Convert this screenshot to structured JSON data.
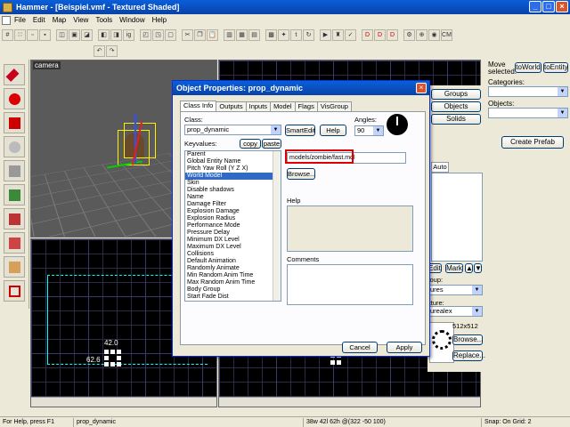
{
  "window": {
    "title": "Hammer - [Beispiel.vmf - Textured Shaded]"
  },
  "menu": [
    "File",
    "Edit",
    "Map",
    "View",
    "Tools",
    "Window",
    "Help"
  ],
  "viewports": {
    "camera_label": "camera",
    "numbers": {
      "a": "42.0",
      "b": "62.6"
    }
  },
  "right_panel": {
    "move_selected": "Move selected:",
    "to_world": "toWorld",
    "to_entity": "toEntity",
    "categories": "Categories:",
    "objects": "Objects:",
    "create_prefab": "Create Prefab",
    "groups": "Groups",
    "objects_btn": "Objects",
    "solids": "Solids",
    "auto": "Auto",
    "edit": "Edit",
    "mark": "Mark",
    "group": "roup:",
    "group_value": "ures",
    "texture": "xture:",
    "texture_value": "urealex",
    "size": "512x512",
    "browse": "Browse...",
    "replace": "Replace..."
  },
  "dialog": {
    "title": "Object Properties: prop_dynamic",
    "tabs": [
      "Class Info",
      "Outputs",
      "Inputs",
      "Model",
      "Flags",
      "VisGroup"
    ],
    "class_label": "Class:",
    "class_value": "prop_dynamic",
    "smartedit": "SmartEdit",
    "help_btn": "Help",
    "angles_label": "Angles:",
    "angles_value": "90",
    "keyvalues_label": "Keyvalues:",
    "copy": "copy",
    "paste": "paste",
    "keyvalues": [
      "Parent",
      "Global Entity Name",
      "Pitch Yaw Roll (Y Z X)",
      "World Model",
      "Skin",
      "Disable shadows",
      "Name",
      "Damage Filter",
      "Explosion Damage",
      "Explosion Radius",
      "Performance Mode",
      "Pressure Delay",
      "Minimum DX Level",
      "Maximum DX Level",
      "Collisions",
      "Default Animation",
      "Randomly Animate",
      "Min Random Anim Time",
      "Max Random Anim Time",
      "Body Group",
      "Start Fade Dist"
    ],
    "selected_index": 3,
    "value_text": "models/zombie/fast.mdl",
    "browse": "Browse...",
    "help_label": "Help",
    "comments_label": "Comments",
    "cancel": "Cancel",
    "apply": "Apply"
  },
  "status": {
    "help": "For Help, press F1",
    "selection": "prop_dynamic",
    "coords": "38w 42l 62h @(322 -50 100)",
    "snap": "Snap: On Grid: 2"
  }
}
